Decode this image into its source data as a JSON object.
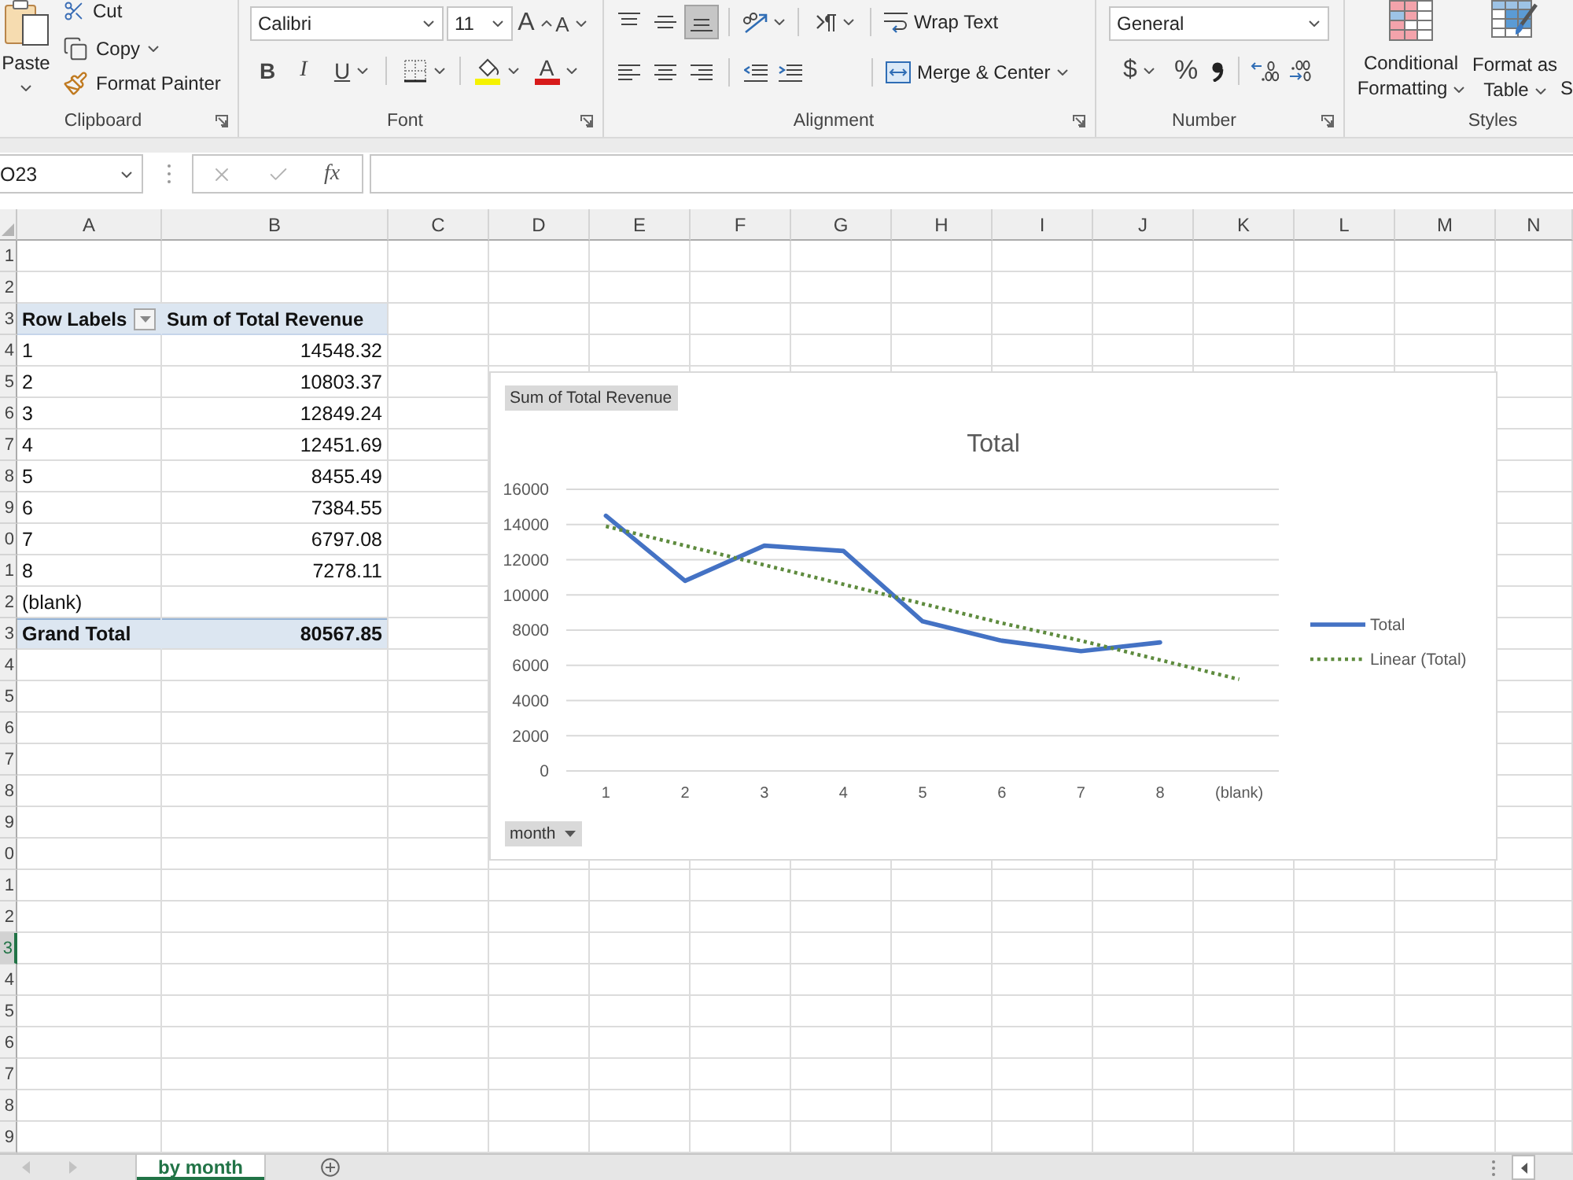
{
  "ribbon": {
    "clipboard": {
      "paste": "Paste",
      "cut": "Cut",
      "copy": "Copy",
      "format_painter": "Format Painter",
      "label": "Clipboard"
    },
    "font": {
      "font_name": "Calibri",
      "font_size": "11",
      "grow_font": "A",
      "shrink_font": "A",
      "bold": "B",
      "italic": "I",
      "underline": "U",
      "font_color": "A",
      "label": "Font"
    },
    "alignment": {
      "vertical": [
        {
          "kind": "top",
          "selected": false
        },
        {
          "kind": "middle",
          "selected": false
        },
        {
          "kind": "bottom",
          "selected": true
        }
      ],
      "horizontal": [
        {
          "kind": "left",
          "selected": false
        },
        {
          "kind": "center",
          "selected": false
        },
        {
          "kind": "right",
          "selected": false
        }
      ],
      "wrap_text": "Wrap Text",
      "merge_center": "Merge & Center",
      "label": "Alignment"
    },
    "number": {
      "format": "General",
      "currency": "$",
      "percent": "%",
      "label": "Number"
    },
    "styles": {
      "conditional_formatting": "Conditional Formatting",
      "format_as_table": "Format as Table",
      "cut_off_button": "S",
      "label": "Styles"
    }
  },
  "formula_bar": {
    "name_box": "O23",
    "entry_buttons_disabled": true,
    "function_label": "fx"
  },
  "sheet": {
    "columns": [
      {
        "label": "A",
        "selected": false
      },
      {
        "label": "B",
        "selected": false
      },
      {
        "label": "C",
        "selected": false
      },
      {
        "label": "D",
        "selected": false
      },
      {
        "label": "E",
        "selected": false
      },
      {
        "label": "F",
        "selected": false
      },
      {
        "label": "G",
        "selected": false
      },
      {
        "label": "H",
        "selected": false
      },
      {
        "label": "I",
        "selected": false
      },
      {
        "label": "J",
        "selected": false
      },
      {
        "label": "K",
        "selected": false
      },
      {
        "label": "L",
        "selected": false
      },
      {
        "label": "M",
        "selected": false
      },
      {
        "label": "N",
        "selected": false
      }
    ],
    "rows": [
      {
        "header": "1",
        "selected": false
      },
      {
        "header": "2",
        "selected": false
      },
      {
        "header": "3",
        "selected": false
      },
      {
        "header": "4",
        "selected": false
      },
      {
        "header": "5",
        "selected": false
      },
      {
        "header": "6",
        "selected": false
      },
      {
        "header": "7",
        "selected": false
      },
      {
        "header": "8",
        "selected": false
      },
      {
        "header": "9",
        "selected": false
      },
      {
        "header": "0",
        "selected": false
      },
      {
        "header": "1",
        "selected": false
      },
      {
        "header": "2",
        "selected": false
      },
      {
        "header": "3",
        "selected": false
      },
      {
        "header": "4",
        "selected": false
      },
      {
        "header": "5",
        "selected": false
      },
      {
        "header": "6",
        "selected": false
      },
      {
        "header": "7",
        "selected": false
      },
      {
        "header": "8",
        "selected": false
      },
      {
        "header": "9",
        "selected": false
      },
      {
        "header": "0",
        "selected": false
      },
      {
        "header": "1",
        "selected": false
      },
      {
        "header": "2",
        "selected": false
      },
      {
        "header": "3",
        "selected": true
      },
      {
        "header": "4",
        "selected": false
      },
      {
        "header": "5",
        "selected": false
      },
      {
        "header": "6",
        "selected": false
      },
      {
        "header": "7",
        "selected": false
      },
      {
        "header": "8",
        "selected": false
      },
      {
        "header": "9",
        "selected": false
      }
    ],
    "pivot_table": {
      "row_labels": "Row Labels",
      "value_header": "Sum of Total Revenue",
      "rows": [
        {
          "label": "1",
          "value": "14548.32"
        },
        {
          "label": "2",
          "value": "10803.37"
        },
        {
          "label": "3",
          "value": "12849.24"
        },
        {
          "label": "4",
          "value": "12451.69"
        },
        {
          "label": "5",
          "value": "8455.49"
        },
        {
          "label": "6",
          "value": "7384.55"
        },
        {
          "label": "7",
          "value": "6797.08"
        },
        {
          "label": "8",
          "value": "7278.11"
        },
        {
          "label": "(blank)"
        }
      ],
      "grand_total": {
        "label": "Grand Total",
        "value": "80567.85"
      }
    },
    "chart": {
      "value_field_button": "Sum of Total Revenue",
      "axis_field_button": "month",
      "chart_data": {
        "type": "line",
        "title": "Total",
        "categories": [
          "1",
          "2",
          "3",
          "4",
          "5",
          "6",
          "7",
          "8",
          "(blank)"
        ],
        "series": [
          {
            "name": "Total",
            "color": "#4472c4",
            "line_style": "solid",
            "values": [
              14500,
              10800,
              12800,
              12500,
              8500,
              7400,
              6800,
              7300,
              null
            ]
          },
          {
            "name": "Linear (Total)",
            "color": "#5e8b3e",
            "line_style": "dotted",
            "values": [
              13900,
              12800,
              11700,
              10600,
              9500,
              8400,
              7400,
              6300,
              5200
            ]
          }
        ],
        "ylim": [
          0,
          16000
        ],
        "yticks": [
          {
            "value": 0,
            "label": "0"
          },
          {
            "value": 2000,
            "label": "2000"
          },
          {
            "value": 4000,
            "label": "4000"
          },
          {
            "value": 6000,
            "label": "6000"
          },
          {
            "value": 8000,
            "label": "8000"
          },
          {
            "value": 10000,
            "label": "10000"
          },
          {
            "value": 12000,
            "label": "12000"
          },
          {
            "value": 14000,
            "label": "14000"
          },
          {
            "value": 16000,
            "label": "16000"
          }
        ],
        "grid": true,
        "legend": "right"
      }
    }
  },
  "sheet_tabs": [
    {
      "label": "by month",
      "selected": true
    }
  ]
}
